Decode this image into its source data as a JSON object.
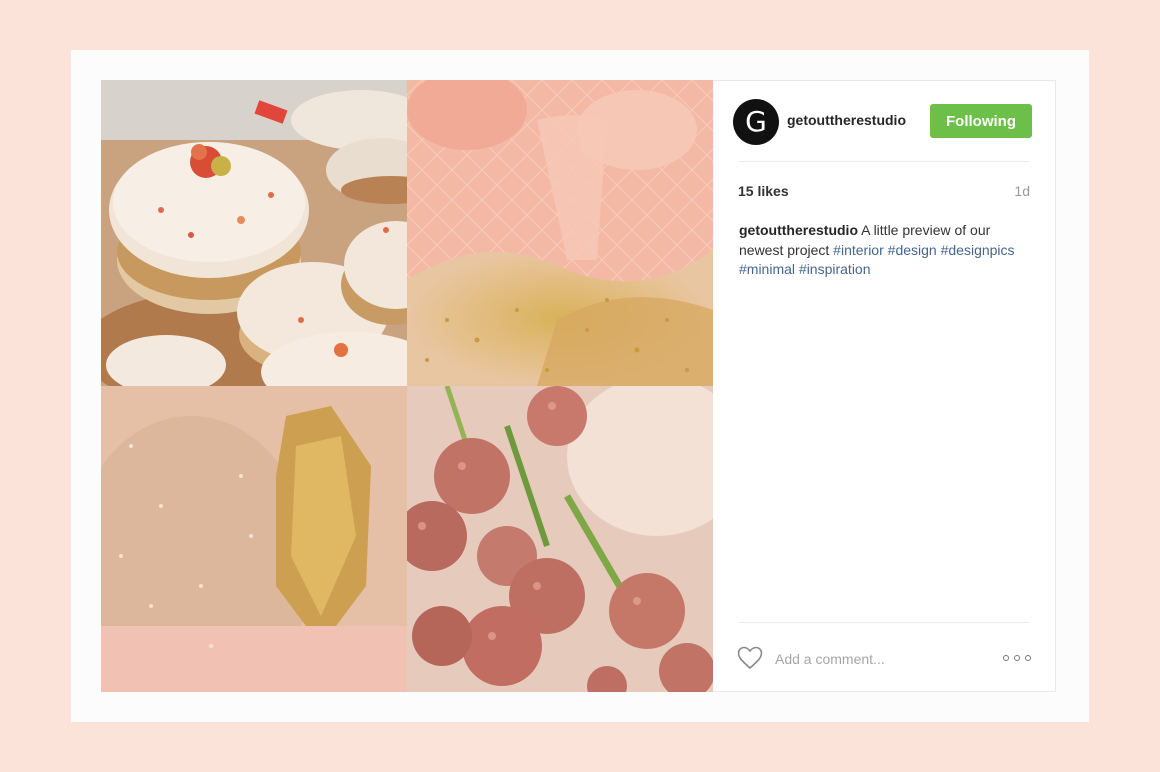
{
  "post": {
    "username": "getouttherestudio",
    "avatar_letter": "G",
    "follow_button": "Following",
    "likes": "15 likes",
    "time": "1d",
    "caption": {
      "user": "getouttherestudio",
      "text": " A little preview of our newest project ",
      "tags": [
        "#interior",
        "#design",
        "#designpics",
        "#minimal",
        "#inspiration"
      ]
    },
    "comment_placeholder": "Add a comment...",
    "images": [
      "macarons-photo",
      "pink-glitter-texture",
      "gold-glitter-texture",
      "pink-flowers-photo"
    ]
  },
  "colors": {
    "page_background": "#fbe3da",
    "follow_button": "#6cc04a",
    "hashtag": "#45668e"
  },
  "icons": [
    "heart-icon",
    "more-options-icon"
  ]
}
